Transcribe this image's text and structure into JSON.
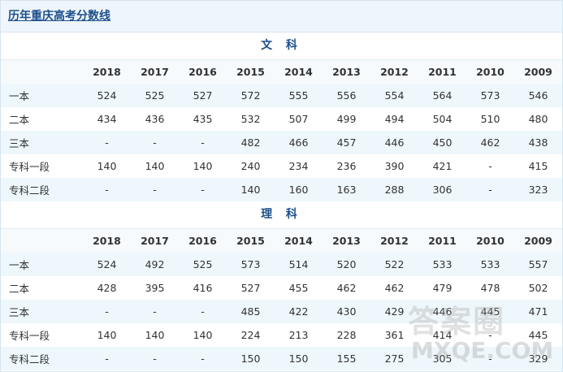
{
  "header": {
    "title": "历年重庆高考分数线"
  },
  "wenke": {
    "title": "文 科",
    "years": [
      "2018",
      "2017",
      "2016",
      "2015",
      "2014",
      "2013",
      "2012",
      "2011",
      "2010",
      "2009"
    ],
    "rows": [
      {
        "label": "一本",
        "values": [
          "524",
          "525",
          "527",
          "572",
          "555",
          "556",
          "554",
          "564",
          "573",
          "546"
        ]
      },
      {
        "label": "二本",
        "values": [
          "434",
          "436",
          "435",
          "532",
          "507",
          "499",
          "494",
          "504",
          "510",
          "480"
        ]
      },
      {
        "label": "三本",
        "values": [
          "-",
          "-",
          "-",
          "482",
          "466",
          "457",
          "446",
          "450",
          "462",
          "438"
        ]
      },
      {
        "label": "专科一段",
        "values": [
          "140",
          "140",
          "140",
          "240",
          "234",
          "236",
          "390",
          "421",
          "-",
          "415"
        ]
      },
      {
        "label": "专科二段",
        "values": [
          "-",
          "-",
          "-",
          "140",
          "160",
          "163",
          "288",
          "306",
          "-",
          "323"
        ]
      }
    ]
  },
  "like": {
    "title": "理 科",
    "years": [
      "2018",
      "2017",
      "2016",
      "2015",
      "2014",
      "2013",
      "2012",
      "2011",
      "2010",
      "2009"
    ],
    "rows": [
      {
        "label": "一本",
        "values": [
          "524",
          "492",
          "525",
          "573",
          "514",
          "520",
          "522",
          "533",
          "533",
          "557"
        ]
      },
      {
        "label": "二本",
        "values": [
          "428",
          "395",
          "416",
          "527",
          "455",
          "462",
          "462",
          "479",
          "478",
          "502"
        ]
      },
      {
        "label": "三本",
        "values": [
          "-",
          "-",
          "-",
          "485",
          "422",
          "430",
          "429",
          "446",
          "445",
          "471"
        ]
      },
      {
        "label": "专科一段",
        "values": [
          "140",
          "140",
          "140",
          "224",
          "213",
          "228",
          "361",
          "414",
          "-",
          "445"
        ]
      },
      {
        "label": "专科二段",
        "values": [
          "-",
          "-",
          "-",
          "150",
          "150",
          "155",
          "275",
          "305",
          "-",
          "329"
        ]
      }
    ]
  },
  "watermark": {
    "glyphs": "答案圈",
    "url": "MXQE.COM"
  }
}
